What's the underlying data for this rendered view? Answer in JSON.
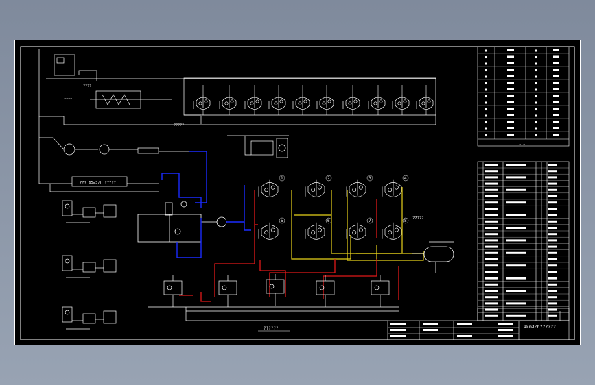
{
  "drawing": {
    "lower_caption": "??????",
    "sheet_title": "15m3/h??????",
    "feed_label": "??? 65m3/h ?????",
    "side_label": "?????",
    "labels": [
      "????",
      "????",
      "?????",
      "??????",
      "?????",
      "?????",
      "?????",
      "?????"
    ],
    "tank_numbers": [
      "1",
      "2",
      "3",
      "4",
      "5",
      "6",
      "7",
      "8"
    ],
    "legend_footer": "1    1"
  },
  "colors": {
    "background": "#000000",
    "frame": "#ffffff",
    "blue_line": "#1a2cff",
    "red_line": "#e01818",
    "yellow_line": "#e8d21a",
    "outer": "#8c97a8"
  }
}
